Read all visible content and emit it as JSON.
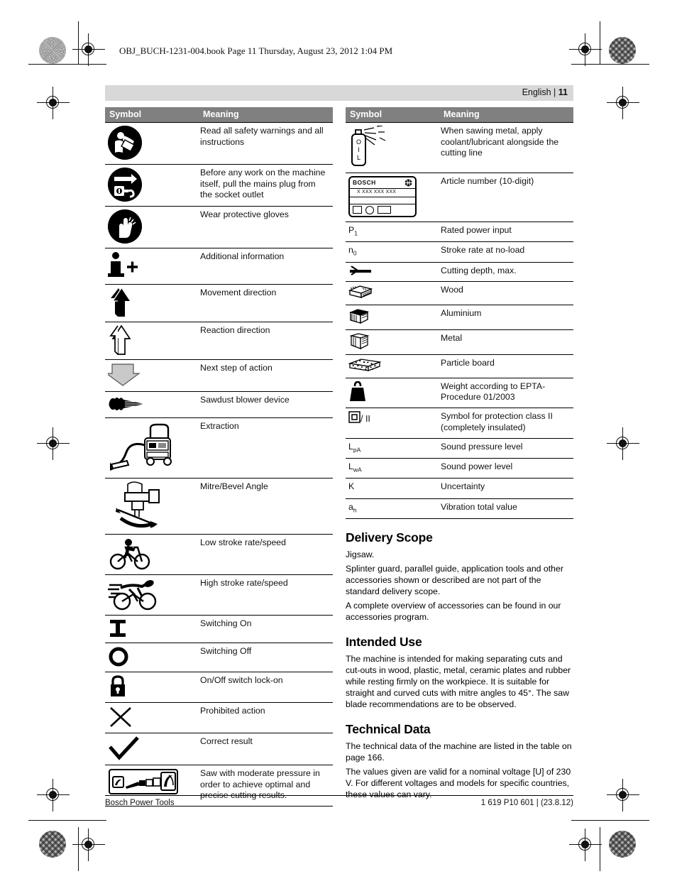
{
  "print_header": "OBJ_BUCH-1231-004.book  Page 11  Thursday, August 23, 2012  1:04 PM",
  "running_head": {
    "language": "English",
    "separator": "|",
    "page_number": "11"
  },
  "table_headers": {
    "symbol": "Symbol",
    "meaning": "Meaning"
  },
  "left_table": [
    {
      "icon": "read-manual-icon",
      "meaning": "Read all safety warnings and all instructions"
    },
    {
      "icon": "unplug-mains-icon",
      "meaning": "Before any work on the machine itself, pull the mains plug from the socket outlet"
    },
    {
      "icon": "protective-gloves-icon",
      "meaning": "Wear protective gloves"
    },
    {
      "icon": "additional-information-icon",
      "meaning": "Additional information"
    },
    {
      "icon": "movement-direction-arrow-icon",
      "meaning": "Movement direction"
    },
    {
      "icon": "reaction-direction-arrow-icon",
      "meaning": "Reaction direction"
    },
    {
      "icon": "next-step-arrow-icon",
      "meaning": "Next step of action"
    },
    {
      "icon": "sawdust-blower-icon",
      "meaning": "Sawdust blower device"
    },
    {
      "icon": "vacuum-extraction-icon",
      "meaning": "Extraction"
    },
    {
      "icon": "mitre-bevel-angle-icon",
      "meaning": "Mitre/Bevel Angle"
    },
    {
      "icon": "low-speed-cyclist-icon",
      "meaning": "Low stroke rate/speed"
    },
    {
      "icon": "high-speed-cyclist-icon",
      "meaning": "High stroke rate/speed"
    },
    {
      "icon": "switch-on-icon",
      "meaning": "Switching On"
    },
    {
      "icon": "switch-off-icon",
      "meaning": "Switching Off"
    },
    {
      "icon": "lock-on-padlock-icon",
      "meaning": "On/Off switch lock-on"
    },
    {
      "icon": "prohibited-action-cross-icon",
      "meaning": "Prohibited action"
    },
    {
      "icon": "correct-result-check-icon",
      "meaning": "Correct result"
    },
    {
      "icon": "moderate-pressure-sawing-icon",
      "meaning": "Saw with moderate pressure in order to achieve optimal and precise cutting results."
    }
  ],
  "right_table": [
    {
      "icon": "coolant-spray-can-icon",
      "label": "",
      "meaning": "When sawing metal, apply coolant/lubricant alongside the cutting line"
    },
    {
      "icon": "bosch-nameplate-icon",
      "label": "",
      "meaning": "Article number (10-digit)"
    },
    {
      "icon": "symbol-text",
      "label": "P1",
      "label_base": "P",
      "label_sub": "1",
      "meaning": "Rated power input"
    },
    {
      "icon": "symbol-text",
      "label": "n0",
      "label_base": "n",
      "label_sub": "0",
      "meaning": "Stroke rate at no-load"
    },
    {
      "icon": "cutting-depth-icon",
      "label": "",
      "meaning": "Cutting depth, max."
    },
    {
      "icon": "wood-block-icon",
      "label": "",
      "meaning": "Wood"
    },
    {
      "icon": "aluminium-block-icon",
      "label": "",
      "meaning": "Aluminium"
    },
    {
      "icon": "metal-block-icon",
      "label": "",
      "meaning": "Metal"
    },
    {
      "icon": "particle-board-icon",
      "label": "",
      "meaning": "Particle board"
    },
    {
      "icon": "weight-icon",
      "label": "",
      "meaning": "Weight according to EPTA-Procedure 01/2003"
    },
    {
      "icon": "protection-class-icon",
      "label": "/ II",
      "meaning": "Symbol for protection class II (completely insulated)"
    },
    {
      "icon": "symbol-text",
      "label": "LpA",
      "label_base": "L",
      "label_sub": "pA",
      "meaning": "Sound pressure level"
    },
    {
      "icon": "symbol-text",
      "label": "LwA",
      "label_base": "L",
      "label_sub": "wA",
      "meaning": "Sound power level"
    },
    {
      "icon": "symbol-text",
      "label": "K",
      "label_base": "K",
      "label_sub": "",
      "meaning": "Uncertainty"
    },
    {
      "icon": "symbol-text",
      "label": "ah",
      "label_base": "a",
      "label_sub": "h",
      "meaning": "Vibration total value"
    }
  ],
  "nameplate": {
    "brand": "BOSCH",
    "article_number": "X XXX XXX XXX"
  },
  "sections": [
    {
      "title": "Delivery Scope",
      "paragraphs": [
        "Jigsaw.",
        "Splinter guard, parallel guide, application tools and other accessories shown or described are not part of the standard delivery scope.",
        "A complete overview of accessories can be found in our accessories program."
      ]
    },
    {
      "title": "Intended Use",
      "paragraphs": [
        "The machine is intended for making separating cuts and cut-outs in wood, plastic, metal, ceramic plates and rubber while resting firmly on the workpiece. It is suitable for straight and curved cuts with mitre angles to 45°. The saw blade recommendations are to be observed."
      ]
    },
    {
      "title": "Technical Data",
      "paragraphs": [
        "The technical data of the machine are listed in the table on page 166.",
        "The values given are valid for a nominal voltage [U] of 230 V. For different voltages and models for specific countries, these values can vary."
      ]
    }
  ],
  "footer": {
    "left": "Bosch Power Tools",
    "right": "1 619 P10 601 | (23.8.12)"
  },
  "colors": {
    "header_band": "#d8d8d8",
    "table_header": "#808080",
    "rule": "#000000",
    "next_step_arrow": "#c9c9c9"
  }
}
